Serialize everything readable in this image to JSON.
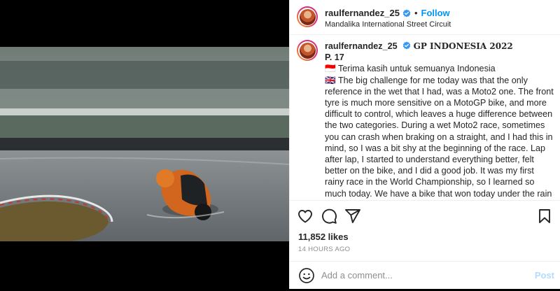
{
  "post": {
    "author": {
      "username": "raulfernandez_25",
      "verified": true,
      "follow_label": "Follow",
      "dot": "•",
      "location": "Mandalika International Street Circuit"
    },
    "caption": {
      "username": "raulfernandez_25",
      "title": "GP INDONESIA 2022",
      "position": "P. 17",
      "line_indonesian": "🇮🇩 Terima kasih untuk semuanya Indonesia",
      "body": "🇬🇧 The big challenge for me today was that the only reference in the wet that I had, was a Moto2 one. The front tyre is much more sensitive on a MotoGP bike, and more difficult to control, which leaves a huge difference between the two categories. During a wet Moto2 race, sometimes you can crash when braking on a straight, and I had this in mind, so I was a bit shy at the beginning of the race. Lap after lap, I started to understand everything better, felt better on the bike, and I did a good job. It was my first rainy race in the World Championship, so I learned so much today. We have a bike that won today under the rain with Miguel Oliveira, so it is a very good bike and I feel very positive about this. Results will come with time, so we will continue the good work"
    },
    "stats": {
      "likes": "11,852 likes",
      "time": "14 HOURS AGO"
    },
    "comment": {
      "placeholder": "Add a comment...",
      "post_label": "Post"
    },
    "icons": {
      "like": "heart-icon",
      "comment": "comment-bubble-icon",
      "share": "paper-plane-icon",
      "save": "bookmark-icon",
      "emoji": "smiley-icon",
      "verified": "verified-badge-icon"
    },
    "colors": {
      "accent": "#0095f6",
      "verified": "#3897f0",
      "post_disabled": "#b3dbff"
    }
  }
}
